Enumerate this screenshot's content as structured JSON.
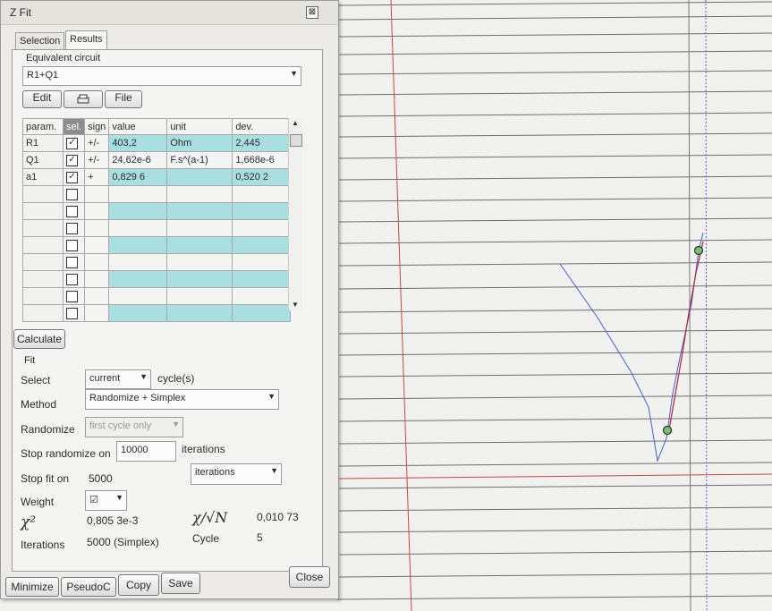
{
  "window": {
    "title": "Z Fit",
    "close_glyph": "⊠"
  },
  "tabs": [
    {
      "label": "Selection"
    },
    {
      "label": "Results",
      "active": true
    }
  ],
  "equivalent": {
    "legend": "Equivalent circuit",
    "value": "R1+Q1",
    "edit_label": "Edit",
    "print_icon": "printer-icon",
    "file_label": "File"
  },
  "table": {
    "headers": {
      "param": "param.",
      "sel": "sel.",
      "sign": "sign",
      "value": "value",
      "unit": "unit",
      "dev": "dev."
    },
    "rows": [
      {
        "param": "R1",
        "sign": "+/-",
        "value": "403,2",
        "unit": "Ohm",
        "dev": "2,445",
        "checked": true
      },
      {
        "param": "Q1",
        "sign": "+/-",
        "value": "24,62e-6",
        "unit": "F.s^(a-1)",
        "dev": "1,668e-6",
        "checked": true
      },
      {
        "param": "a1",
        "sign": "+",
        "value": "0,829 6",
        "unit": "",
        "dev": "0,520 2",
        "checked": true
      },
      {
        "param": "",
        "sign": "",
        "value": "",
        "unit": "",
        "dev": "",
        "checked": false
      },
      {
        "param": "",
        "sign": "",
        "value": "",
        "unit": "",
        "dev": "",
        "checked": false
      },
      {
        "param": "",
        "sign": "",
        "value": "",
        "unit": "",
        "dev": "",
        "checked": false
      },
      {
        "param": "",
        "sign": "",
        "value": "",
        "unit": "",
        "dev": "",
        "checked": false
      },
      {
        "param": "",
        "sign": "",
        "value": "",
        "unit": "",
        "dev": "",
        "checked": false
      },
      {
        "param": "",
        "sign": "",
        "value": "",
        "unit": "",
        "dev": "",
        "checked": false
      },
      {
        "param": "",
        "sign": "",
        "value": "",
        "unit": "",
        "dev": "",
        "checked": false
      },
      {
        "param": "",
        "sign": "",
        "value": "",
        "unit": "",
        "dev": "",
        "checked": false
      }
    ]
  },
  "calculate_label": "Calculate",
  "fit": {
    "legend": "Fit",
    "select_label": "Select",
    "select_value": "current",
    "select_suffix": "cycle(s)",
    "method_label": "Method",
    "method_value": "Randomize + Simplex",
    "randomize_label": "Randomize",
    "randomize_value": "first cycle only",
    "stop_randomize_label": "Stop randomize on",
    "stop_randomize_value": "10000",
    "stop_randomize_unit": "iterations",
    "stop_fit_label": "Stop fit on",
    "stop_fit_value": "5000",
    "stop_fit_unit": "iterations",
    "weight_label": "Weight",
    "weight_value": "☑",
    "chi2_label": "χ²",
    "chi2_value": "0,805 3e-3",
    "chi_sqrtn_label": "χ/√N",
    "chi_sqrtn_value": "0,010 73",
    "iterations_label": "Iterations",
    "iterations_value": "5000 (Simplex)",
    "cycle_label": "Cycle",
    "cycle_value": "5"
  },
  "bottom_buttons": {
    "minimize": "Minimize",
    "pseudoc": "PseudoC",
    "copy": "Copy",
    "save": "Save",
    "close": "Close"
  },
  "colors": {
    "grid": "#6e6e6e",
    "axis": "#c44a4a",
    "data_line": "#4a5fcf",
    "fit_line": "#b03040",
    "marker": "#7cc06a",
    "row_highlight": "#aadfe2"
  }
}
